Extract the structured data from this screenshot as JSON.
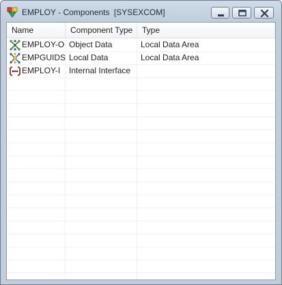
{
  "window": {
    "title": "EMPLOY - Components",
    "tag": "[SYSEXCOM]",
    "icons": {
      "app": "components-app-icon",
      "minimize": "minimize-icon",
      "maximize": "maximize-icon",
      "close": "close-icon"
    }
  },
  "table": {
    "columns": [
      "Name",
      "Component Type",
      "Type"
    ],
    "rows": [
      {
        "name": "EMPLOY-O",
        "component_type": "Object Data",
        "type": "Local Data Area",
        "icon": "object-data-icon"
      },
      {
        "name": "EMPGUIDS",
        "component_type": "Local Data",
        "type": "Local Data Area",
        "icon": "local-data-icon"
      },
      {
        "name": "EMPLOY-I",
        "component_type": "Internal Interface",
        "type": "",
        "icon": "internal-interface-icon"
      }
    ]
  },
  "colors": {
    "titlebar": "#c7d5e4",
    "border": "#6f7a86",
    "close_red": "#c0392b"
  }
}
